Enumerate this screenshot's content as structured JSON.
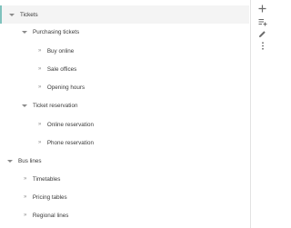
{
  "tree": {
    "tickets": {
      "label": "Tickets",
      "expanded": true,
      "selected": true
    },
    "purchasing_tickets": {
      "label": "Purchasing tickets",
      "expanded": true
    },
    "buy_online": {
      "label": "Buy online"
    },
    "sale_offices": {
      "label": "Sale offices"
    },
    "opening_hours": {
      "label": "Opening hours"
    },
    "ticket_reservation": {
      "label": "Ticket reservation",
      "expanded": true
    },
    "online_reservation": {
      "label": "Online reservation"
    },
    "phone_reservation": {
      "label": "Phone reservation"
    },
    "bus_lines": {
      "label": "Bus lines",
      "expanded": true
    },
    "timetables": {
      "label": "Timetables"
    },
    "pricing_tables": {
      "label": "Pricing tables"
    },
    "regional_lines": {
      "label": "Regional lines"
    }
  },
  "toolbar": {
    "add_icon": "plus-icon",
    "add_sub_icon": "add-subitem-icon",
    "edit_icon": "pencil-icon",
    "more_icon": "more-vertical-icon"
  },
  "colors": {
    "selected_bg": "#f4f4f4",
    "selected_accent": "#7fc2bd",
    "text": "#3a3a3a",
    "icon": "#8a8a8a"
  }
}
